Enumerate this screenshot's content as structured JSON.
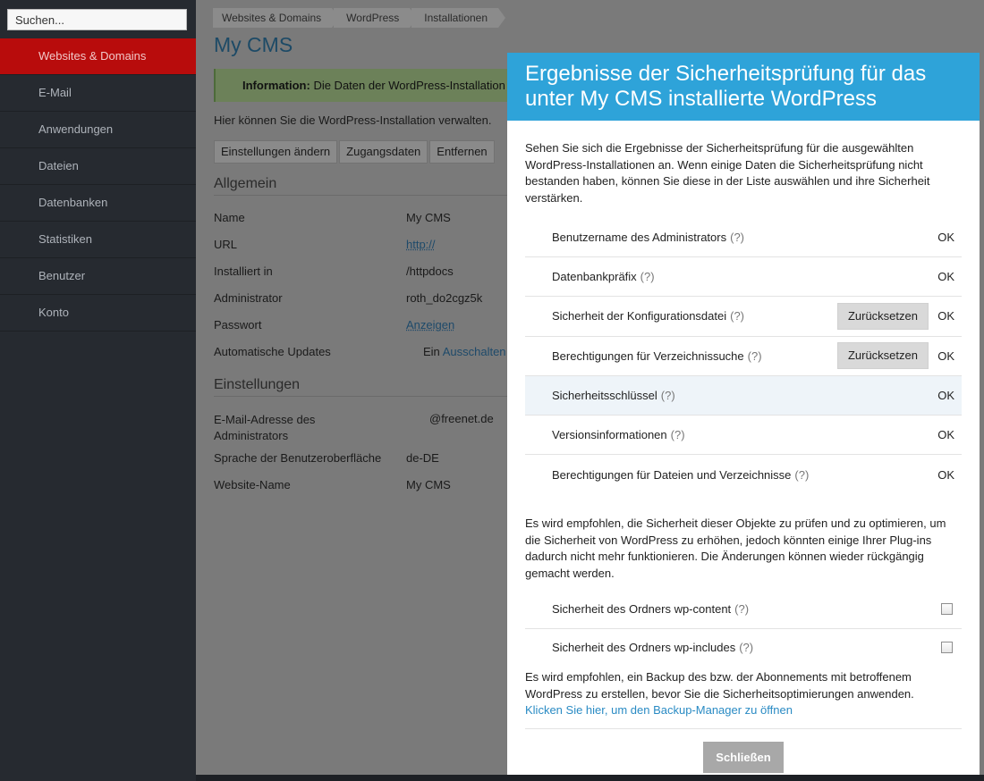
{
  "sidebar": {
    "search_placeholder": "Suchen...",
    "items": [
      {
        "label": "Websites & Domains",
        "active": true
      },
      {
        "label": "E-Mail"
      },
      {
        "label": "Anwendungen"
      },
      {
        "label": "Dateien"
      },
      {
        "label": "Datenbanken"
      },
      {
        "label": "Statistiken"
      },
      {
        "label": "Benutzer"
      },
      {
        "label": "Konto"
      }
    ]
  },
  "main": {
    "breadcrumb": [
      "Websites & Domains",
      "WordPress",
      "Installationen"
    ],
    "title": "My CMS",
    "info_label": "Information:",
    "info_text": " Die Daten der WordPress-Installation",
    "intro": "Hier können Sie die WordPress-Installation verwalten.",
    "tabs": [
      "Einstellungen ändern",
      "Zugangsdaten",
      "Entfernen"
    ],
    "general_heading": "Allgemein",
    "general": [
      {
        "label": "Name",
        "value": "My CMS"
      },
      {
        "label": "URL",
        "value": "http://"
      },
      {
        "label": "Installiert in",
        "value": "/httpdocs"
      },
      {
        "label": "Administrator",
        "value": "roth_do2cgz5k"
      },
      {
        "label": "Passwort",
        "value": "Anzeigen"
      },
      {
        "label": "Automatische Updates",
        "value": "Ein",
        "link": "Ausschalten"
      }
    ],
    "settings_heading": "Einstellungen",
    "settings": [
      {
        "label": "E-Mail-Adresse des Administrators",
        "value": "@freenet.de"
      },
      {
        "label": "Sprache der Benutzeroberfläche",
        "value": "de-DE"
      },
      {
        "label": "Website-Name",
        "value": "My CMS"
      }
    ]
  },
  "modal": {
    "title": "Ergebnisse der Sicherheitsprüfung für das unter My CMS installierte WordPress",
    "description": "Sehen Sie sich die Ergebnisse der Sicherheitsprüfung für die ausgewählten WordPress-Installationen an. Wenn einige Daten die Sicherheitsprüfung nicht bestanden haben, können Sie diese in der Liste auswählen und ihre Sicherheit verstärken.",
    "help_mark": "(?)",
    "checks": [
      {
        "label": "Benutzername des Administrators",
        "status": "OK"
      },
      {
        "label": "Datenbankpräfix",
        "status": "OK"
      },
      {
        "label": "Sicherheit der Konfigurationsdatei",
        "status": "OK",
        "button": "Zurücksetzen"
      },
      {
        "label": "Berechtigungen für Verzeichnissuche",
        "status": "OK",
        "button": "Zurücksetzen"
      },
      {
        "label": "Sicherheitsschlüssel",
        "status": "OK"
      },
      {
        "label": "Versionsinformationen",
        "status": "OK"
      },
      {
        "label": "Berechtigungen für Dateien und Verzeichnisse",
        "status": "OK"
      }
    ],
    "recommendation": "Es wird empfohlen, die Sicherheit dieser Objekte zu prüfen und zu optimieren, um die Sicherheit von WordPress zu erhöhen, jedoch könnten einige Ihrer Plug-ins dadurch nicht mehr funktionieren. Die Änderungen können wieder rückgängig gemacht werden.",
    "options": [
      {
        "label": "Sicherheit des Ordners wp-content",
        "checked": false
      },
      {
        "label": "Sicherheit des Ordners wp-includes",
        "checked": false
      }
    ],
    "backup_note": "Es wird empfohlen, ein Backup des bzw. der Abonnements mit betroffenem WordPress zu erstellen, bevor Sie die Sicherheitsoptimierungen anwenden.",
    "backup_link": "Klicken Sie hier, um den Backup-Manager zu öffnen",
    "close_label": "Schließen"
  },
  "colors": {
    "accent": "#2ea3d9",
    "sidebar_active": "#b80c0c",
    "link": "#2a8bc4"
  }
}
